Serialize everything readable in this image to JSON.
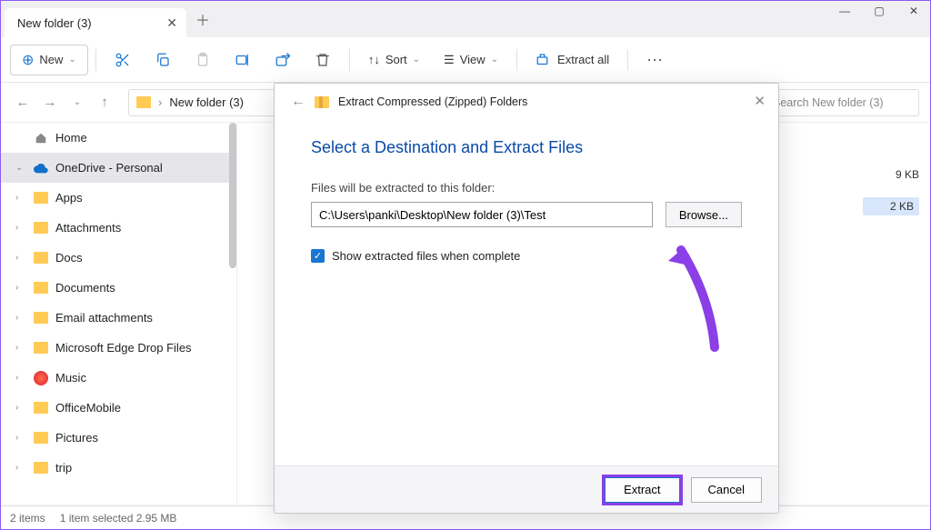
{
  "tab_title": "New folder (3)",
  "toolbar": {
    "new_label": "New",
    "sort_label": "Sort",
    "view_label": "View",
    "extract_all_label": "Extract all"
  },
  "breadcrumb": {
    "segment": "New folder (3)"
  },
  "search_placeholder": "Search New folder (3)",
  "sidebar": {
    "home": "Home",
    "onedrive": "OneDrive - Personal",
    "items": [
      "Apps",
      "Attachments",
      "Docs",
      "Documents",
      "Email attachments",
      "Microsoft Edge Drop Files",
      "Music",
      "OfficeMobile",
      "Pictures",
      "trip"
    ]
  },
  "files": {
    "row1_size": "9 KB",
    "row2_size": "2 KB"
  },
  "dialog": {
    "title_line": "Extract Compressed (Zipped) Folders",
    "heading": "Select a Destination and Extract Files",
    "sub": "Files will be extracted to this folder:",
    "path": "C:\\Users\\panki\\Desktop\\New folder (3)\\Test",
    "browse": "Browse...",
    "show_extracted": "Show extracted files when complete",
    "extract": "Extract",
    "cancel": "Cancel"
  },
  "status": {
    "left": "2 items",
    "mid": "1 item selected  2.95 MB"
  }
}
